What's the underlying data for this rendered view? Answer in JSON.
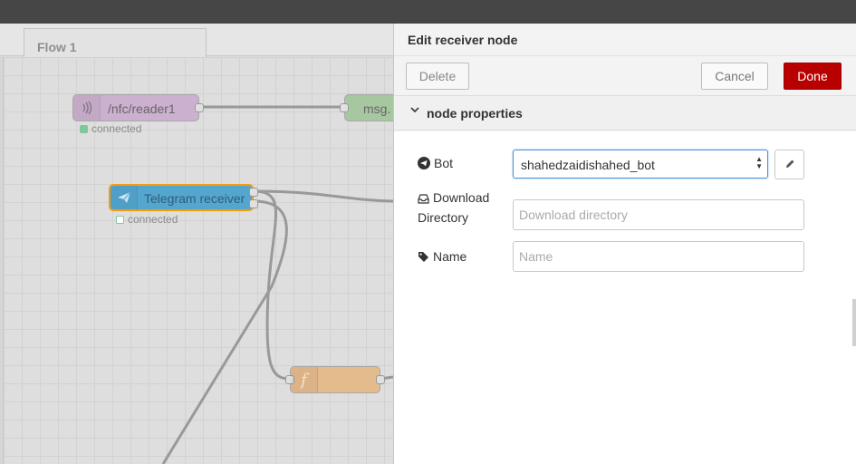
{
  "workspace": {
    "tab_label": "Flow 1",
    "nodes": [
      {
        "name": "nfc-reader-node",
        "label": "/nfc/reader1",
        "icon": "nfc-icon",
        "color": "#cbb0cf",
        "status": "connected",
        "status_color": "#7ec89b"
      },
      {
        "name": "msg-node",
        "label": "msg.",
        "color": "#a6c7a0"
      },
      {
        "name": "telegram-receiver-node",
        "label": "Telegram receiver",
        "icon": "paper-plane-icon",
        "color": "#54a6cf",
        "status": "connected",
        "status_color": "#7ec89b"
      },
      {
        "name": "function-node",
        "label": "",
        "icon": "function-icon",
        "color": "#e4bb8c"
      }
    ]
  },
  "tray": {
    "title": "Edit receiver node",
    "buttons": {
      "delete": "Delete",
      "cancel": "Cancel",
      "done": "Done"
    },
    "section_title": "node properties",
    "fields": {
      "bot": {
        "label": "Bot",
        "value": "shahedzaidishahed_bot"
      },
      "download": {
        "label_line1": "Download",
        "label_line2": "Directory",
        "placeholder": "Download directory"
      },
      "name": {
        "label": "Name",
        "placeholder": "Name"
      }
    }
  }
}
